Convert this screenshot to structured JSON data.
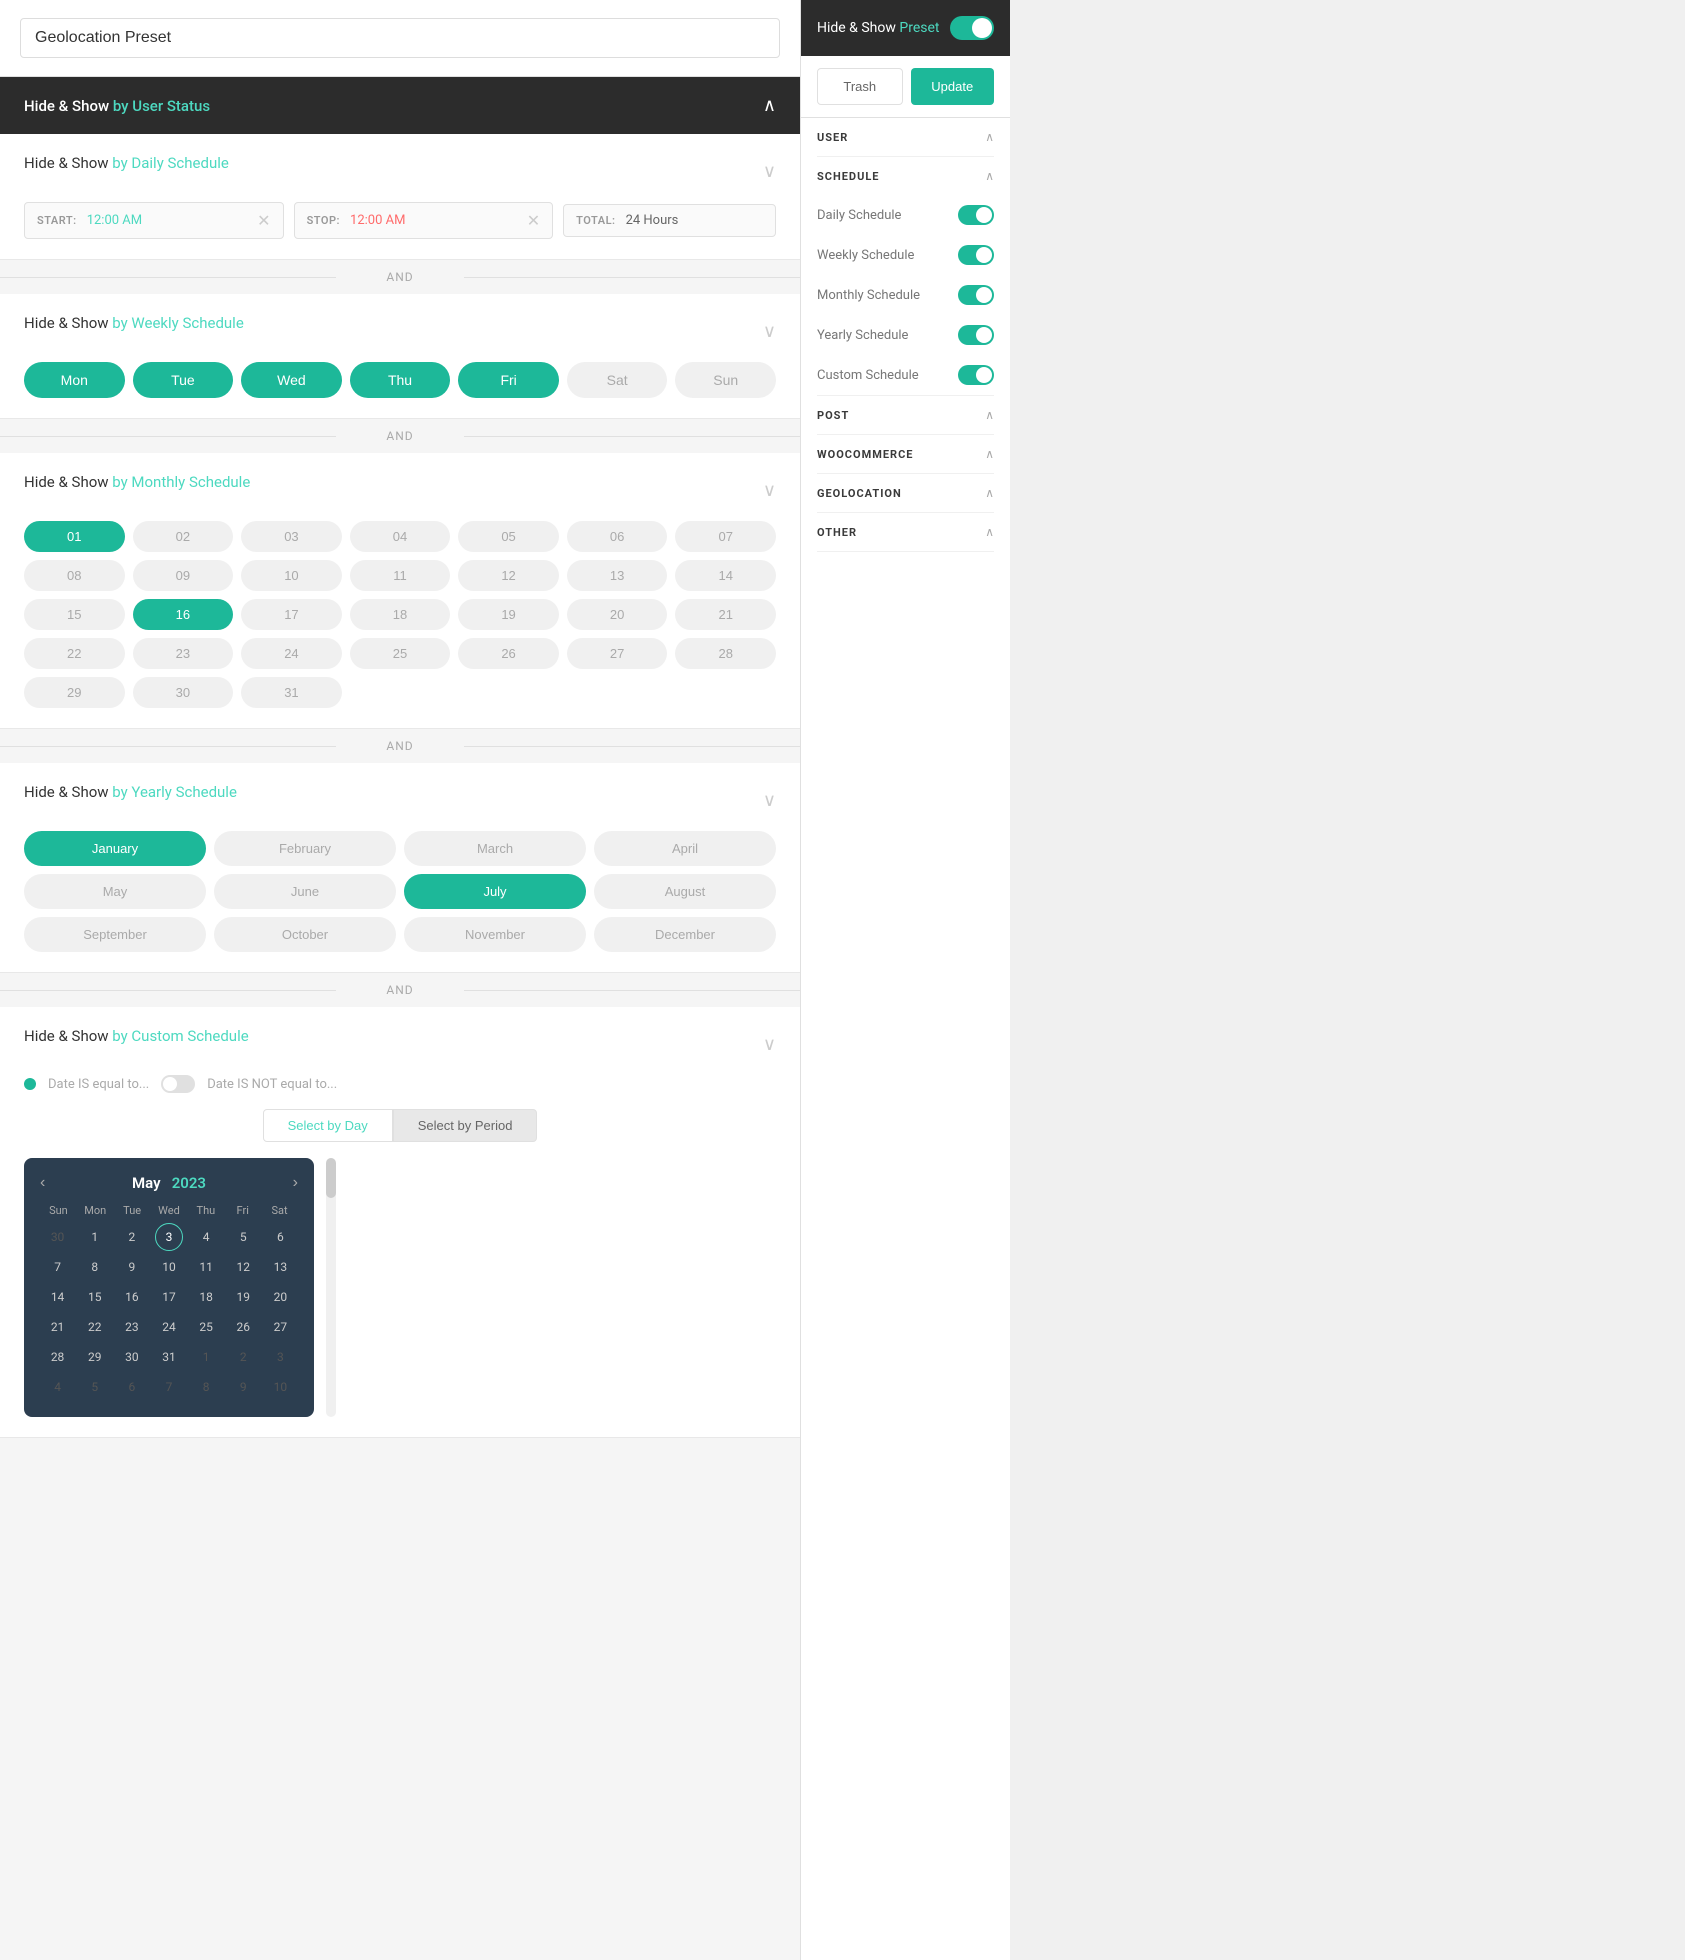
{
  "preset": {
    "title": "Geolocation Preset",
    "titlePlaceholder": "Geolocation Preset"
  },
  "header": {
    "title": "Hide & Show ",
    "titleSpan": "by User Status",
    "chevron": "∧"
  },
  "daily": {
    "sectionTitle": "Hide & Show ",
    "sectionTitleSpan": "by Daily Schedule",
    "startLabel": "START:",
    "startValue": "12:00 AM",
    "stopLabel": "STOP:",
    "stopValue": "12:00 AM",
    "totalLabel": "TOTAL:",
    "totalValue": "24 Hours"
  },
  "weekly": {
    "sectionTitle": "Hide & Show ",
    "sectionTitleSpan": "by Weekly Schedule",
    "days": [
      {
        "label": "Mon",
        "active": true
      },
      {
        "label": "Tue",
        "active": true
      },
      {
        "label": "Wed",
        "active": true
      },
      {
        "label": "Thu",
        "active": true
      },
      {
        "label": "Fri",
        "active": true
      },
      {
        "label": "Sat",
        "active": false
      },
      {
        "label": "Sun",
        "active": false
      }
    ]
  },
  "monthly": {
    "sectionTitle": "Hide & Show ",
    "sectionTitleSpan": "by Monthly Schedule",
    "days": [
      {
        "label": "01",
        "active": true
      },
      {
        "label": "02",
        "active": false
      },
      {
        "label": "03",
        "active": false
      },
      {
        "label": "04",
        "active": false
      },
      {
        "label": "05",
        "active": false
      },
      {
        "label": "06",
        "active": false
      },
      {
        "label": "07",
        "active": false
      },
      {
        "label": "08",
        "active": false
      },
      {
        "label": "09",
        "active": false
      },
      {
        "label": "10",
        "active": false
      },
      {
        "label": "11",
        "active": false
      },
      {
        "label": "12",
        "active": false
      },
      {
        "label": "13",
        "active": false
      },
      {
        "label": "14",
        "active": false
      },
      {
        "label": "15",
        "active": false
      },
      {
        "label": "16",
        "active": true
      },
      {
        "label": "17",
        "active": false
      },
      {
        "label": "18",
        "active": false
      },
      {
        "label": "19",
        "active": false
      },
      {
        "label": "20",
        "active": false
      },
      {
        "label": "21",
        "active": false
      },
      {
        "label": "22",
        "active": false
      },
      {
        "label": "23",
        "active": false
      },
      {
        "label": "24",
        "active": false
      },
      {
        "label": "25",
        "active": false
      },
      {
        "label": "26",
        "active": false
      },
      {
        "label": "27",
        "active": false
      },
      {
        "label": "28",
        "active": false
      },
      {
        "label": "29",
        "active": false
      },
      {
        "label": "30",
        "active": false
      },
      {
        "label": "31",
        "active": false
      }
    ]
  },
  "yearly": {
    "sectionTitle": "Hide & Show ",
    "sectionTitleSpan": "by Yearly Schedule",
    "months": [
      {
        "label": "January",
        "active": true
      },
      {
        "label": "February",
        "active": false
      },
      {
        "label": "March",
        "active": false
      },
      {
        "label": "April",
        "active": false
      },
      {
        "label": "May",
        "active": false
      },
      {
        "label": "June",
        "active": false
      },
      {
        "label": "July",
        "active": true
      },
      {
        "label": "August",
        "active": false
      },
      {
        "label": "September",
        "active": false
      },
      {
        "label": "October",
        "active": false
      },
      {
        "label": "November",
        "active": false
      },
      {
        "label": "December",
        "active": false
      }
    ]
  },
  "custom": {
    "sectionTitle": "Hide & Show ",
    "sectionTitleSpan": "by Custom Schedule",
    "option1": "Date IS equal to...",
    "option2": "Date IS NOT equal to...",
    "tab1": "Select by Day",
    "tab2": "Select by Period"
  },
  "calendar": {
    "month": "May",
    "year": "2023",
    "dayHeaders": [
      "Sun",
      "Mon",
      "Tue",
      "Wed",
      "Thu",
      "Fri",
      "Sat"
    ],
    "weeks": [
      [
        {
          "label": "30",
          "type": "other"
        },
        {
          "label": "1",
          "type": "normal"
        },
        {
          "label": "2",
          "type": "normal"
        },
        {
          "label": "3",
          "type": "current"
        },
        {
          "label": "4",
          "type": "normal"
        },
        {
          "label": "5",
          "type": "normal"
        },
        {
          "label": "6",
          "type": "normal"
        }
      ],
      [
        {
          "label": "7",
          "type": "normal"
        },
        {
          "label": "8",
          "type": "normal"
        },
        {
          "label": "9",
          "type": "normal"
        },
        {
          "label": "10",
          "type": "normal"
        },
        {
          "label": "11",
          "type": "normal"
        },
        {
          "label": "12",
          "type": "normal"
        },
        {
          "label": "13",
          "type": "normal"
        }
      ],
      [
        {
          "label": "14",
          "type": "normal"
        },
        {
          "label": "15",
          "type": "normal"
        },
        {
          "label": "16",
          "type": "normal"
        },
        {
          "label": "17",
          "type": "normal"
        },
        {
          "label": "18",
          "type": "normal"
        },
        {
          "label": "19",
          "type": "normal"
        },
        {
          "label": "20",
          "type": "normal"
        }
      ],
      [
        {
          "label": "21",
          "type": "normal"
        },
        {
          "label": "22",
          "type": "normal"
        },
        {
          "label": "23",
          "type": "normal"
        },
        {
          "label": "24",
          "type": "normal"
        },
        {
          "label": "25",
          "type": "normal"
        },
        {
          "label": "26",
          "type": "normal"
        },
        {
          "label": "27",
          "type": "normal"
        }
      ],
      [
        {
          "label": "28",
          "type": "normal"
        },
        {
          "label": "29",
          "type": "normal"
        },
        {
          "label": "30",
          "type": "normal"
        },
        {
          "label": "31",
          "type": "normal"
        },
        {
          "label": "1",
          "type": "other"
        },
        {
          "label": "2",
          "type": "other"
        },
        {
          "label": "3",
          "type": "other"
        }
      ],
      [
        {
          "label": "4",
          "type": "other"
        },
        {
          "label": "5",
          "type": "other"
        },
        {
          "label": "6",
          "type": "other"
        },
        {
          "label": "7",
          "type": "other"
        },
        {
          "label": "8",
          "type": "other"
        },
        {
          "label": "9",
          "type": "other"
        },
        {
          "label": "10",
          "type": "other"
        }
      ]
    ]
  },
  "rightPanel": {
    "title": "Hide & Show ",
    "titleSpan": "Preset",
    "trashLabel": "Trash",
    "updateLabel": "Update",
    "sections": [
      {
        "label": "USER",
        "expanded": true,
        "items": []
      },
      {
        "label": "SCHEDULE",
        "expanded": true,
        "items": [
          {
            "label": "Daily Schedule",
            "toggled": true
          },
          {
            "label": "Weekly Schedule",
            "toggled": true
          },
          {
            "label": "Monthly Schedule",
            "toggled": true
          },
          {
            "label": "Yearly Schedule",
            "toggled": true
          },
          {
            "label": "Custom Schedule",
            "toggled": true
          }
        ]
      },
      {
        "label": "POST",
        "expanded": true,
        "items": []
      },
      {
        "label": "WOOCOMMERCE",
        "expanded": true,
        "items": []
      },
      {
        "label": "GEOLOCATION",
        "expanded": true,
        "items": []
      },
      {
        "label": "OTHER",
        "expanded": true,
        "items": []
      }
    ]
  },
  "andLabel": "AND"
}
